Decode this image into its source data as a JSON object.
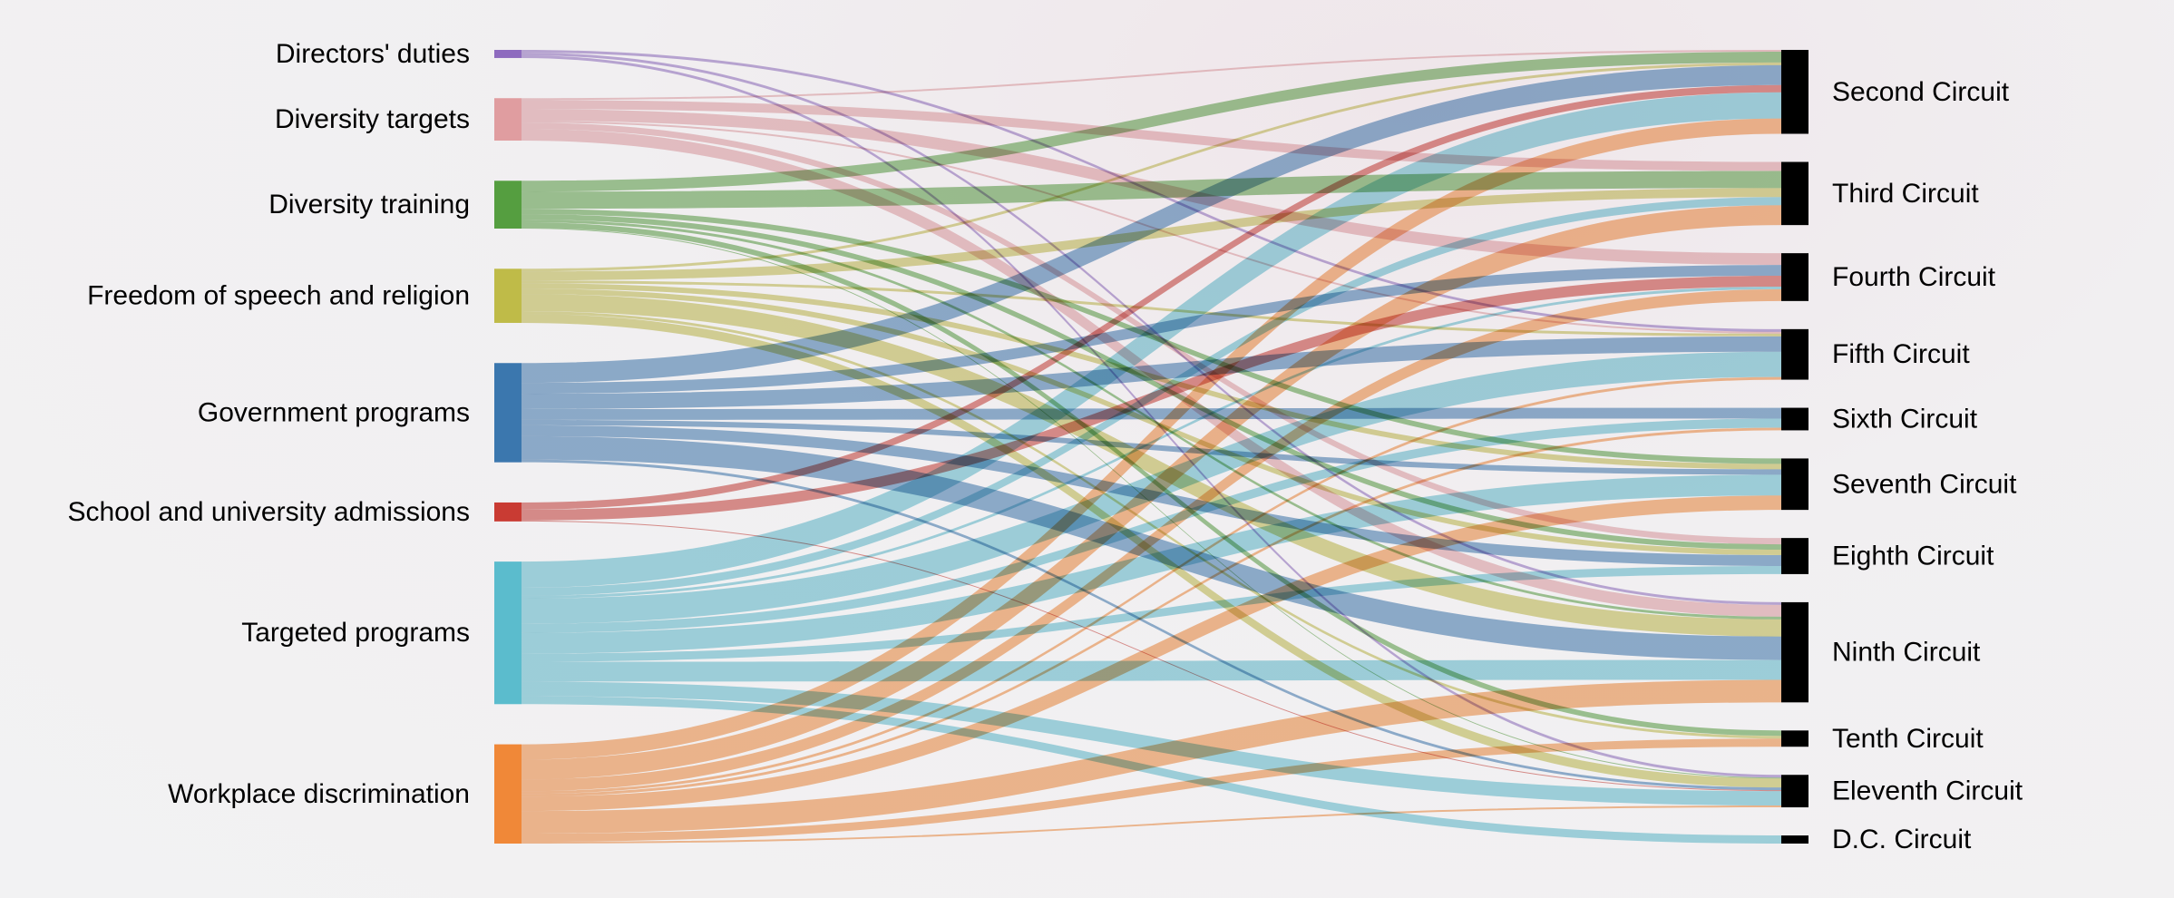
{
  "chart_data": {
    "type": "sankey",
    "title": "",
    "sources": [
      {
        "name": "Directors' duties",
        "color": "#8e6bbf"
      },
      {
        "name": "Diversity targets",
        "color": "#e09da0"
      },
      {
        "name": "Diversity training",
        "color": "#559e40"
      },
      {
        "name": "Freedom of speech and religion",
        "color": "#bfbb48"
      },
      {
        "name": "Government programs",
        "color": "#3b77ae"
      },
      {
        "name": "School and university admissions",
        "color": "#c93b33"
      },
      {
        "name": "Targeted programs",
        "color": "#5bbccd"
      },
      {
        "name": "Workplace discrimination",
        "color": "#f08838"
      }
    ],
    "targets": [
      {
        "name": "Second Circuit",
        "color": "#000000"
      },
      {
        "name": "Third Circuit",
        "color": "#000000"
      },
      {
        "name": "Fourth Circuit",
        "color": "#000000"
      },
      {
        "name": "Fifth Circuit",
        "color": "#000000"
      },
      {
        "name": "Sixth Circuit",
        "color": "#000000"
      },
      {
        "name": "Seventh Circuit",
        "color": "#000000"
      },
      {
        "name": "Eighth Circuit",
        "color": "#000000"
      },
      {
        "name": "Ninth Circuit",
        "color": "#000000"
      },
      {
        "name": "Tenth Circuit",
        "color": "#000000"
      },
      {
        "name": "Eleventh Circuit",
        "color": "#000000"
      },
      {
        "name": "D.C. Circuit",
        "color": "#000000"
      }
    ],
    "links": [
      {
        "source": "Directors' duties",
        "target": "Fifth Circuit",
        "value": 3
      },
      {
        "source": "Directors' duties",
        "target": "Ninth Circuit",
        "value": 3
      },
      {
        "source": "Directors' duties",
        "target": "Eleventh Circuit",
        "value": 3
      },
      {
        "source": "Diversity targets",
        "target": "Second Circuit",
        "value": 2
      },
      {
        "source": "Diversity targets",
        "target": "Third Circuit",
        "value": 10
      },
      {
        "source": "Diversity targets",
        "target": "Fourth Circuit",
        "value": 13
      },
      {
        "source": "Diversity targets",
        "target": "Fifth Circuit",
        "value": 2
      },
      {
        "source": "Diversity targets",
        "target": "Eighth Circuit",
        "value": 7
      },
      {
        "source": "Diversity targets",
        "target": "Ninth Circuit",
        "value": 13
      },
      {
        "source": "Diversity training",
        "target": "Second Circuit",
        "value": 12
      },
      {
        "source": "Diversity training",
        "target": "Third Circuit",
        "value": 19
      },
      {
        "source": "Diversity training",
        "target": "Seventh Circuit",
        "value": 6
      },
      {
        "source": "Diversity training",
        "target": "Eighth Circuit",
        "value": 6
      },
      {
        "source": "Diversity training",
        "target": "Ninth Circuit",
        "value": 3
      },
      {
        "source": "Diversity training",
        "target": "Tenth Circuit",
        "value": 6
      },
      {
        "source": "Diversity training",
        "target": "Eleventh Circuit",
        "value": 1
      },
      {
        "source": "Freedom of speech and religion",
        "target": "Second Circuit",
        "value": 3
      },
      {
        "source": "Freedom of speech and religion",
        "target": "Third Circuit",
        "value": 10
      },
      {
        "source": "Freedom of speech and religion",
        "target": "Fifth Circuit",
        "value": 3
      },
      {
        "source": "Freedom of speech and religion",
        "target": "Seventh Circuit",
        "value": 6
      },
      {
        "source": "Freedom of speech and religion",
        "target": "Eighth Circuit",
        "value": 6
      },
      {
        "source": "Freedom of speech and religion",
        "target": "Ninth Circuit",
        "value": 19
      },
      {
        "source": "Freedom of speech and religion",
        "target": "Tenth Circuit",
        "value": 3
      },
      {
        "source": "Freedom of speech and religion",
        "target": "Eleventh Circuit",
        "value": 10
      },
      {
        "source": "Government programs",
        "target": "Second Circuit",
        "value": 22
      },
      {
        "source": "Government programs",
        "target": "Fourth Circuit",
        "value": 12
      },
      {
        "source": "Government programs",
        "target": "Fifth Circuit",
        "value": 17
      },
      {
        "source": "Government programs",
        "target": "Sixth Circuit",
        "value": 12
      },
      {
        "source": "Government programs",
        "target": "Seventh Circuit",
        "value": 6
      },
      {
        "source": "Government programs",
        "target": "Eighth Circuit",
        "value": 12
      },
      {
        "source": "Government programs",
        "target": "Ninth Circuit",
        "value": 26
      },
      {
        "source": "Government programs",
        "target": "Eleventh Circuit",
        "value": 3
      },
      {
        "source": "School and university admissions",
        "target": "Second Circuit",
        "value": 8
      },
      {
        "source": "School and university admissions",
        "target": "Fourth Circuit",
        "value": 12
      },
      {
        "source": "School and university admissions",
        "target": "Eleventh Circuit",
        "value": 1
      },
      {
        "source": "Targeted programs",
        "target": "Second Circuit",
        "value": 29
      },
      {
        "source": "Targeted programs",
        "target": "Third Circuit",
        "value": 9
      },
      {
        "source": "Targeted programs",
        "target": "Fourth Circuit",
        "value": 3
      },
      {
        "source": "Targeted programs",
        "target": "Fifth Circuit",
        "value": 28
      },
      {
        "source": "Targeted programs",
        "target": "Sixth Circuit",
        "value": 10
      },
      {
        "source": "Targeted programs",
        "target": "Seventh Circuit",
        "value": 23
      },
      {
        "source": "Targeted programs",
        "target": "Eighth Circuit",
        "value": 9
      },
      {
        "source": "Targeted programs",
        "target": "Ninth Circuit",
        "value": 22
      },
      {
        "source": "Targeted programs",
        "target": "Eleventh Circuit",
        "value": 16
      },
      {
        "source": "Targeted programs",
        "target": "D.C. Circuit",
        "value": 9
      },
      {
        "source": "Workplace discrimination",
        "target": "Second Circuit",
        "value": 17
      },
      {
        "source": "Workplace discrimination",
        "target": "Third Circuit",
        "value": 22
      },
      {
        "source": "Workplace discrimination",
        "target": "Fourth Circuit",
        "value": 13
      },
      {
        "source": "Workplace discrimination",
        "target": "Fifth Circuit",
        "value": 3
      },
      {
        "source": "Workplace discrimination",
        "target": "Sixth Circuit",
        "value": 3
      },
      {
        "source": "Workplace discrimination",
        "target": "Seventh Circuit",
        "value": 16
      },
      {
        "source": "Workplace discrimination",
        "target": "Ninth Circuit",
        "value": 25
      },
      {
        "source": "Workplace discrimination",
        "target": "Tenth Circuit",
        "value": 9
      },
      {
        "source": "Workplace discrimination",
        "target": "Eleventh Circuit",
        "value": 2
      }
    ],
    "link_opacity": 0.55
  }
}
